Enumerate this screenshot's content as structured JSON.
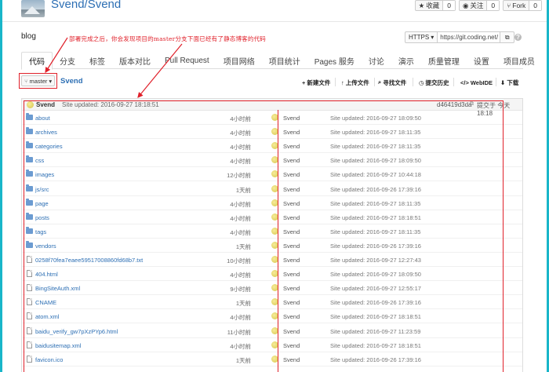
{
  "repo": {
    "title": "Svend/Svend",
    "actions": [
      {
        "label": "收藏",
        "count": "0",
        "icon": "star-icon"
      },
      {
        "label": "关注",
        "count": "0",
        "icon": "eye-icon"
      },
      {
        "label": "Fork",
        "count": "0",
        "icon": "fork-icon"
      }
    ]
  },
  "blog_label": "blog",
  "annotation_text": "部署完成之后，你会发现项目的master分支下面已经有了静态博客的代码",
  "clone": {
    "type": "HTTPS",
    "url": "https://git.coding.net/"
  },
  "tabs": [
    "代码",
    "分支",
    "标签",
    "版本对比",
    "Pull Request",
    "项目网络",
    "项目统计",
    "Pages 服务",
    "讨论",
    "演示",
    "质量管理",
    "设置",
    "项目成员"
  ],
  "active_tab": "代码",
  "branch": "master",
  "repo_link": "Svend",
  "toolbar": {
    "new_file": "新建文件",
    "upload_file": "上传文件",
    "find_file": "寻找文件",
    "commit_history": "提交历史",
    "webide": "WebIDE",
    "download": "下载"
  },
  "latest_commit": {
    "user": "Svend",
    "message": "Site updated: 2016-09-27 18:18:51",
    "hash": "d46419d3da",
    "time": "提交于 今天 18:18"
  },
  "files": [
    {
      "name": "about",
      "type": "folder",
      "age": "4小时前",
      "user": "Svend",
      "message": "Site updated: 2016-09-27 18:09:50"
    },
    {
      "name": "archives",
      "type": "folder",
      "age": "4小时前",
      "user": "Svend",
      "message": "Site updated: 2016-09-27 18:11:35"
    },
    {
      "name": "categories",
      "type": "folder",
      "age": "4小时前",
      "user": "Svend",
      "message": "Site updated: 2016-09-27 18:11:35"
    },
    {
      "name": "css",
      "type": "folder",
      "age": "4小时前",
      "user": "Svend",
      "message": "Site updated: 2016-09-27 18:09:50"
    },
    {
      "name": "images",
      "type": "folder",
      "age": "12小时前",
      "user": "Svend",
      "message": "Site updated: 2016-09-27 10:44:18"
    },
    {
      "name": "js/src",
      "type": "folder",
      "age": "1天前",
      "user": "Svend",
      "message": "Site updated: 2016-09-26 17:39:16"
    },
    {
      "name": "page",
      "type": "folder",
      "age": "4小时前",
      "user": "Svend",
      "message": "Site updated: 2016-09-27 18:11:35"
    },
    {
      "name": "posts",
      "type": "folder",
      "age": "4小时前",
      "user": "Svend",
      "message": "Site updated: 2016-09-27 18:18:51"
    },
    {
      "name": "tags",
      "type": "folder",
      "age": "4小时前",
      "user": "Svend",
      "message": "Site updated: 2016-09-27 18:11:35"
    },
    {
      "name": "vendors",
      "type": "folder",
      "age": "1天前",
      "user": "Svend",
      "message": "Site updated: 2016-09-26 17:39:16"
    },
    {
      "name": "0258f70fea7eaee59517008860fd68b7.txt",
      "type": "file",
      "age": "10小时前",
      "user": "Svend",
      "message": "Site updated: 2016-09-27 12:27:43"
    },
    {
      "name": "404.html",
      "type": "file",
      "age": "4小时前",
      "user": "Svend",
      "message": "Site updated: 2016-09-27 18:09:50"
    },
    {
      "name": "BingSiteAuth.xml",
      "type": "file",
      "age": "9小时前",
      "user": "Svend",
      "message": "Site updated: 2016-09-27 12:55:17"
    },
    {
      "name": "CNAME",
      "type": "file",
      "age": "1天前",
      "user": "Svend",
      "message": "Site updated: 2016-09-26 17:39:16"
    },
    {
      "name": "atom.xml",
      "type": "file",
      "age": "4小时前",
      "user": "Svend",
      "message": "Site updated: 2016-09-27 18:18:51"
    },
    {
      "name": "baidu_verify_gw7pXzPYp6.html",
      "type": "file",
      "age": "11小时前",
      "user": "Svend",
      "message": "Site updated: 2016-09-27 11:23:59"
    },
    {
      "name": "baidusitemap.xml",
      "type": "file",
      "age": "4小时前",
      "user": "Svend",
      "message": "Site updated: 2016-09-27 18:18:51"
    },
    {
      "name": "favicon.ico",
      "type": "file",
      "age": "1天前",
      "user": "Svend",
      "message": "Site updated: 2016-09-26 17:39:16"
    }
  ],
  "colors": {
    "link": "#2d6fb4",
    "annotation": "#e0202a",
    "frame": "#19b6c9"
  }
}
